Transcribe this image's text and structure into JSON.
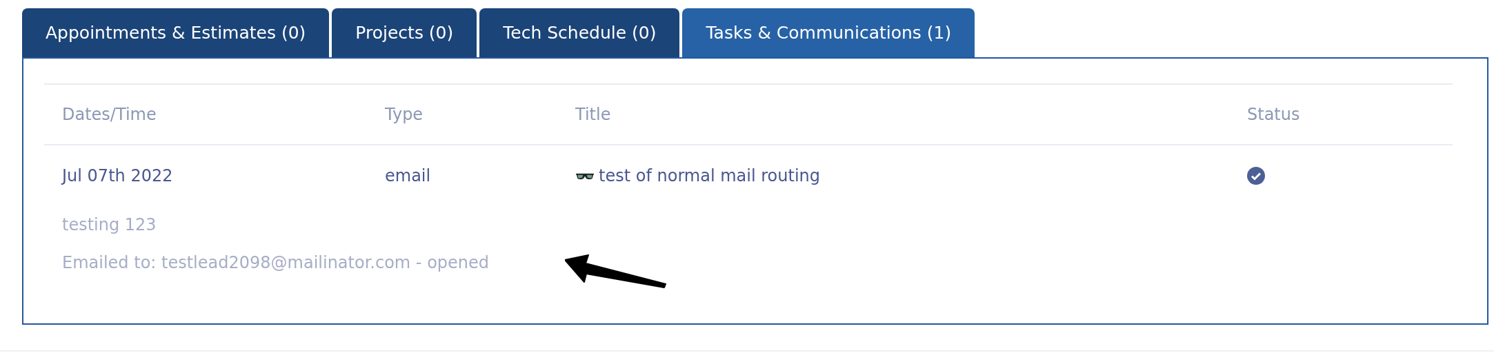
{
  "tabs": [
    {
      "label": "Appointments & Estimates (0)",
      "selected": false
    },
    {
      "label": "Projects (0)",
      "selected": false
    },
    {
      "label": "Tech Schedule (0)",
      "selected": false
    },
    {
      "label": "Tasks & Communications (1)",
      "selected": true
    }
  ],
  "table": {
    "columns": [
      "Dates/Time",
      "Type",
      "Title",
      "Status"
    ],
    "rows": [
      {
        "date": "Jul 07th 2022",
        "type": "email",
        "title": "test of normal mail routing",
        "done": true,
        "details": [
          "testing 123",
          "Emailed to: testlead2098@mailinator.com - opened"
        ]
      }
    ]
  }
}
